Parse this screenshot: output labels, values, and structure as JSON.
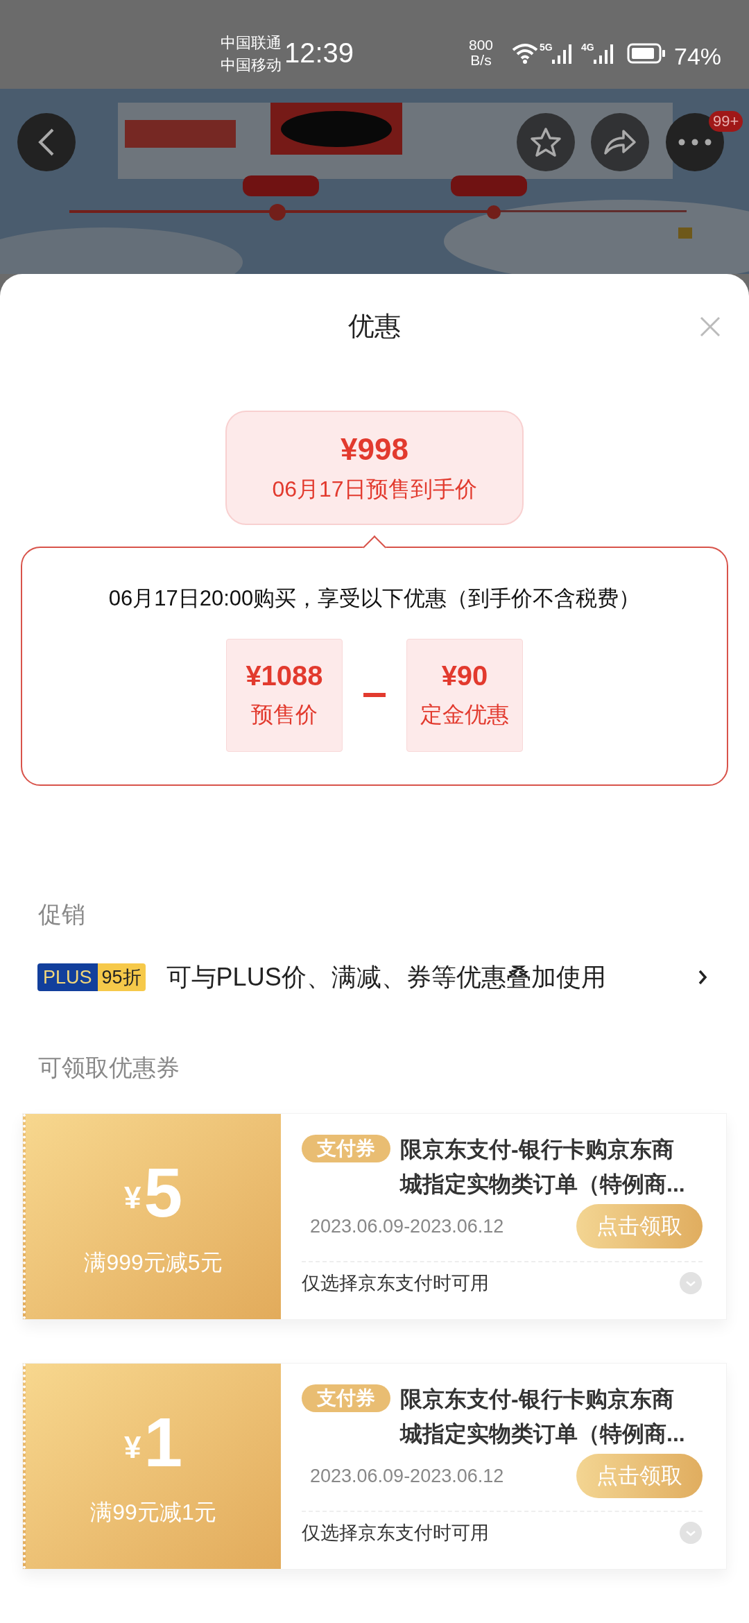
{
  "status_bar": {
    "carriers": [
      "中国联通",
      "中国移动"
    ],
    "time": "12:39",
    "speed": [
      "800",
      "B/s"
    ],
    "networks": [
      "5G",
      "4G"
    ],
    "battery": "74%"
  },
  "header": {
    "badge": "99+"
  },
  "sheet": {
    "title": "优惠"
  },
  "final_price": {
    "price": "¥998",
    "label": "06月17日预售到手价"
  },
  "breakdown": {
    "note": "06月17日20:00购买，享受以下优惠（到手价不含税费）",
    "items": [
      {
        "price": "¥1088",
        "label": "预售价"
      },
      {
        "price": "¥90",
        "label": "定金优惠"
      }
    ]
  },
  "promotions": {
    "heading": "促销",
    "items": [
      {
        "badge": "PLUS",
        "discount": "95折",
        "text": "可与PLUS价、满减、券等优惠叠加使用"
      }
    ]
  },
  "coupons": {
    "heading": "可领取优惠券",
    "items": [
      {
        "currency": "¥",
        "amount": "5",
        "condition": "满999元减5元",
        "tag": "支付券",
        "title": "限京东支付-银行卡购京东商城指定实物类订单（特例商...",
        "validity": "2023.06.09-2023.06.12",
        "action": "点击领取",
        "note": "仅选择京东支付时可用"
      },
      {
        "currency": "¥",
        "amount": "1",
        "condition": "满99元减1元",
        "tag": "支付券",
        "title": "限京东支付-银行卡购京东商城指定实物类订单（特例商...",
        "validity": "2023.06.09-2023.06.12",
        "action": "点击领取",
        "note": "仅选择京东支付时可用"
      }
    ]
  }
}
